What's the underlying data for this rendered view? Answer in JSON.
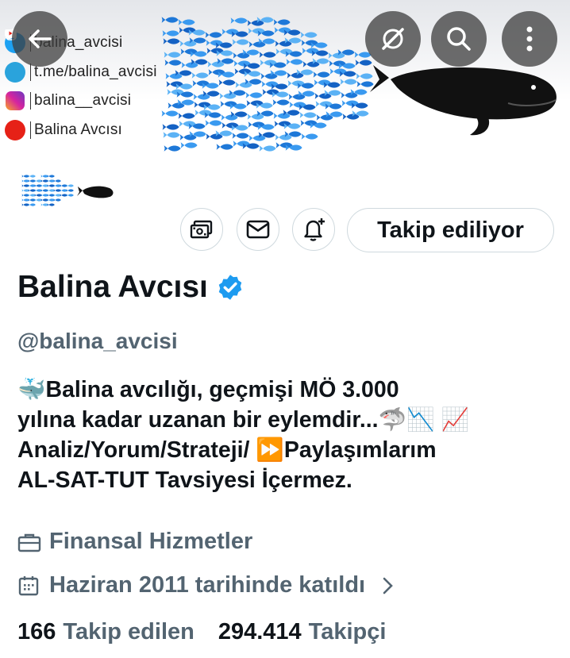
{
  "banner": {
    "social": [
      {
        "icon": "twitter-icon",
        "text": "balina_avcisi",
        "color": "#1da1f2"
      },
      {
        "icon": "telegram-icon",
        "text": "t.me/balina_avcisi",
        "color": "#2aa3dc"
      },
      {
        "icon": "instagram-icon",
        "text": "balina__avcisi",
        "color": "#d6249f"
      },
      {
        "icon": "youtube-icon",
        "text": "Balina Avcısı",
        "color": "#e62117"
      }
    ]
  },
  "actions": {
    "follow_label": "Takip ediliyor"
  },
  "profile": {
    "name": "Balina Avcısı",
    "handle": "@balina_avcisi",
    "bio_lines": [
      "🐳Balina avcılığı, geçmişi MÖ 3.000",
      "yılına kadar uzanan bir eylemdir...🦈📉 📈",
      "Analiz/Yorum/Strateji/ ⏩Paylaşımlarım",
      "AL-SAT-TUT Tavsiyesi İçermez."
    ],
    "category": "Finansal Hizmetler",
    "joined": "Haziran 2011 tarihinde katıldı",
    "following_count": "166",
    "following_label": "Takip edilen",
    "followers_count": "294.414",
    "followers_label": "Takipçi"
  },
  "colors": {
    "verified": "#1d9bf0",
    "secondary_text": "#536471",
    "fish": "#1e78d8"
  }
}
